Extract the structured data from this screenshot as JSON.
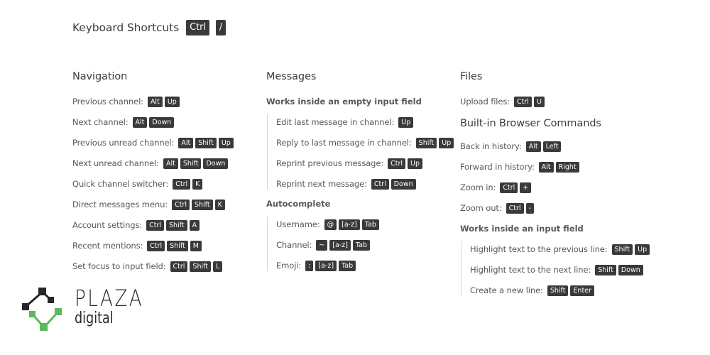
{
  "header": {
    "title": "Keyboard Shortcuts",
    "keys": [
      "Ctrl",
      "/"
    ]
  },
  "navigation": {
    "title": "Navigation",
    "items": [
      {
        "label": "Previous channel:",
        "keys": [
          "Alt",
          "Up"
        ]
      },
      {
        "label": "Next channel:",
        "keys": [
          "Alt",
          "Down"
        ]
      },
      {
        "label": "Previous unread channel:",
        "keys": [
          "Alt",
          "Shift",
          "Up"
        ]
      },
      {
        "label": "Next unread channel:",
        "keys": [
          "Alt",
          "Shift",
          "Down"
        ]
      },
      {
        "label": "Quick channel switcher:",
        "keys": [
          "Ctrl",
          "K"
        ]
      },
      {
        "label": "Direct messages menu:",
        "keys": [
          "Ctrl",
          "Shift",
          "K"
        ]
      },
      {
        "label": "Account settings:",
        "keys": [
          "Ctrl",
          "Shift",
          "A"
        ]
      },
      {
        "label": "Recent mentions:",
        "keys": [
          "Ctrl",
          "Shift",
          "M"
        ]
      },
      {
        "label": "Set focus to input field:",
        "keys": [
          "Ctrl",
          "Shift",
          "L"
        ]
      }
    ]
  },
  "messages": {
    "title": "Messages",
    "empty_input": {
      "title": "Works inside an empty input field",
      "items": [
        {
          "label": "Edit last message in channel:",
          "keys": [
            "Up"
          ]
        },
        {
          "label": "Reply to last message in channel:",
          "keys": [
            "Shift",
            "Up"
          ]
        },
        {
          "label": "Reprint previous message:",
          "keys": [
            "Ctrl",
            "Up"
          ]
        },
        {
          "label": "Reprint next message:",
          "keys": [
            "Ctrl",
            "Down"
          ]
        }
      ]
    },
    "autocomplete": {
      "title": "Autocomplete",
      "items": [
        {
          "label": "Username:",
          "keys": [
            "@",
            "[a-z]",
            "Tab"
          ]
        },
        {
          "label": "Channel:",
          "keys": [
            "~",
            "[a-z]",
            "Tab"
          ]
        },
        {
          "label": "Emoji:",
          "keys": [
            ":",
            "[a-z]",
            "Tab"
          ]
        }
      ]
    }
  },
  "files": {
    "title": "Files",
    "items": [
      {
        "label": "Upload files:",
        "keys": [
          "Ctrl",
          "U"
        ]
      }
    ]
  },
  "browser": {
    "title": "Built-in Browser Commands",
    "items": [
      {
        "label": "Back in history:",
        "keys": [
          "Alt",
          "Left"
        ]
      },
      {
        "label": "Forward in history:",
        "keys": [
          "Alt",
          "Right"
        ]
      },
      {
        "label": "Zoom in:",
        "keys": [
          "Ctrl",
          "+"
        ]
      },
      {
        "label": "Zoom out:",
        "keys": [
          "Ctrl",
          "-"
        ]
      }
    ],
    "input_field": {
      "title": "Works inside an input field",
      "items": [
        {
          "label": "Highlight text to the previous line:",
          "keys": [
            "Shift",
            "Up"
          ]
        },
        {
          "label": "Highlight text to the next line:",
          "keys": [
            "Shift",
            "Down"
          ]
        },
        {
          "label": "Create a new line:",
          "keys": [
            "Shift",
            "Enter"
          ]
        }
      ]
    }
  },
  "logo": {
    "name": "PLAZA",
    "tagline": "digital",
    "colors": {
      "dark": "#262626",
      "green": "#5cb85c"
    }
  },
  "colors": {
    "key_bg": "#3a3a3d",
    "key_text": "#ffffff",
    "text": "#57565a",
    "heading": "#3d3c40"
  }
}
